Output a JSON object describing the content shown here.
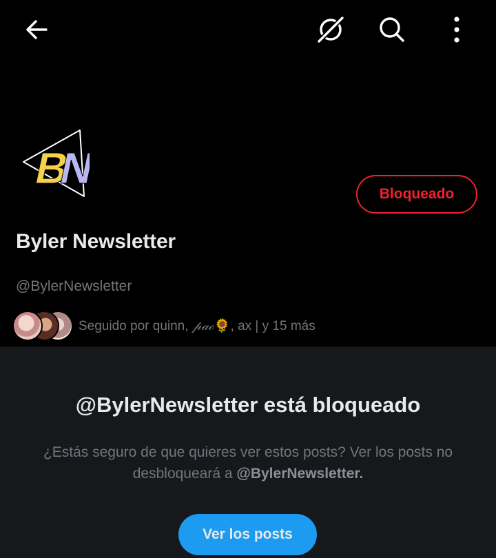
{
  "profile": {
    "display_name": "Byler Newsletter",
    "handle": "@BylerNewsletter",
    "avatar_text": "BN",
    "blocked_label": "Bloqueado",
    "followed_by_prefix": "Seguido por quinn, ",
    "followed_by_stylized": "𝓅𝒶ℴ",
    "followed_by_emoji": "🌻",
    "followed_by_suffix": ", ax | y 15 más"
  },
  "blocked": {
    "title": "@BylerNewsletter está bloqueado",
    "desc_part1": "¿Estás seguro de que quieres ver estos posts? Ver los posts no desbloqueará a ",
    "desc_handle": "@BylerNewsletter.",
    "view_button_label": "Ver los posts"
  },
  "icons": {
    "back": "arrow-left-icon",
    "grok": "grok-icon",
    "search": "search-icon",
    "more": "more-vertical-icon"
  },
  "colors": {
    "background": "#000000",
    "panel": "#16181c",
    "accent_blue": "#1d9bf0",
    "blocked_red": "#f4212e",
    "secondary_text": "#71767b",
    "avatar_yellow": "#f6d24b",
    "avatar_lavender": "#b9b6f2"
  }
}
